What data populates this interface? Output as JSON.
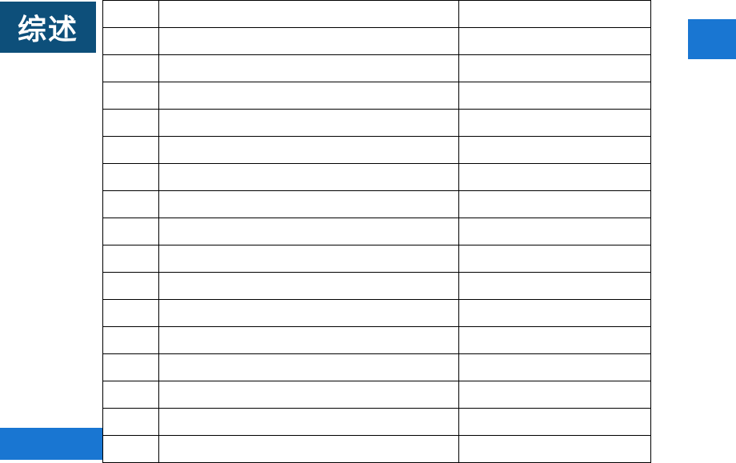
{
  "title": "综述",
  "table": {
    "rows": 17,
    "columns": 3
  }
}
